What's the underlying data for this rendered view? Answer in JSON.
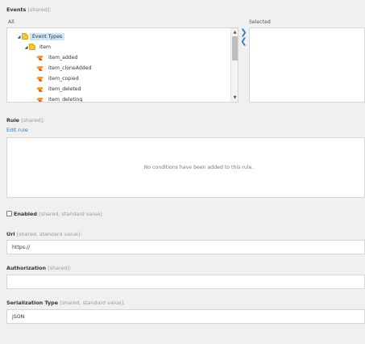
{
  "events": {
    "label": "Events",
    "meta": "[shared]:",
    "all_label": "All",
    "selected_label": "Selected",
    "tree": {
      "root": "Event Types",
      "folder": "Item",
      "items": [
        "item_added",
        "item_cloneAdded",
        "item_copied",
        "item_deleted",
        "item_deleting"
      ]
    },
    "add_arrow": "❯",
    "remove_arrow": "❮",
    "scroll_up": "▲",
    "scroll_down": "▼",
    "expand_glyph": "◢"
  },
  "rule": {
    "label": "Rule",
    "meta": "[shared]:",
    "edit_link": "Edit rule",
    "empty_text": "No conditions have been added to this rule."
  },
  "enabled": {
    "label": "Enabled",
    "meta": "[shared, standard value]",
    "checked": false
  },
  "url": {
    "label": "Url",
    "meta": "[shared, standard value]:",
    "value": "https://"
  },
  "authorization": {
    "label": "Authorization",
    "meta": "[shared]:",
    "value": ""
  },
  "serialization": {
    "label": "Serialization Type",
    "meta": "[shared, standard value]:",
    "value": "JSON"
  },
  "colors": {
    "background": "#f0f0f0",
    "accent": "#2b7bc8",
    "selection": "#cde6f7",
    "folder": "#f4c542",
    "event_icon": "#f39a33"
  }
}
